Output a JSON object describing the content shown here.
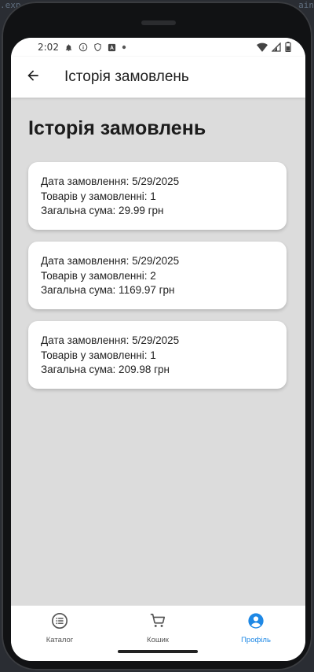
{
  "status_bar": {
    "time": "2:02"
  },
  "app_bar": {
    "title": "Історія замовлень"
  },
  "page": {
    "heading": "Історія замовлень"
  },
  "orders": [
    {
      "date_line": "Дата замовлення: 5/29/2025",
      "items_line": "Товарів у замовленні: 1",
      "total_line": "Загальна сума: 29.99 грн"
    },
    {
      "date_line": "Дата замовлення: 5/29/2025",
      "items_line": "Товарів у замовленні: 2",
      "total_line": "Загальна сума: 1169.97 грн"
    },
    {
      "date_line": "Дата замовлення: 5/29/2025",
      "items_line": "Товарів у замовленні: 1",
      "total_line": "Загальна сума: 209.98 грн"
    }
  ],
  "bottom_nav": {
    "items": [
      {
        "label": "Каталог",
        "icon": "list-icon"
      },
      {
        "label": "Кошик",
        "icon": "cart-icon"
      },
      {
        "label": "Профіль",
        "icon": "profile-icon"
      }
    ],
    "active_index": 2,
    "active_color": "#1e88e5"
  }
}
